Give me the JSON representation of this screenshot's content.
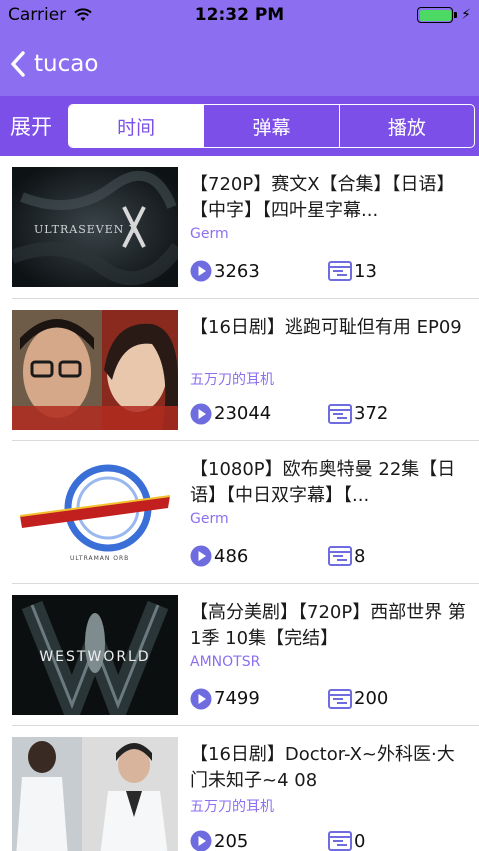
{
  "status_bar": {
    "carrier": "Carrier",
    "time": "12:32 PM"
  },
  "nav": {
    "title": "tucao"
  },
  "filter": {
    "expand_label": "展开",
    "segments": [
      {
        "label": "时间",
        "active": true
      },
      {
        "label": "弹幕",
        "active": false
      },
      {
        "label": "播放",
        "active": false
      }
    ]
  },
  "videos": [
    {
      "title": "【720P】赛文X【合集】【日语】【中字】【四叶星字幕...",
      "uploader": "Germ",
      "plays": "3263",
      "danmaku": "13",
      "thumb_text": "ULTRASEVEN X"
    },
    {
      "title": "【16日剧】逃跑可耻但有用 EP09",
      "uploader": "五万刀的耳机",
      "plays": "23044",
      "danmaku": "372"
    },
    {
      "title": "【1080P】欧布奥特曼 22集【日语】【中日双字幕】【...",
      "uploader": "Germ",
      "plays": "486",
      "danmaku": "8",
      "thumb_text": "ULTRAMAN ORB"
    },
    {
      "title": "【高分美剧】【720P】西部世界 第1季 10集【完结】",
      "uploader": "AMNOTSR",
      "plays": "7499",
      "danmaku": "200",
      "thumb_text": "WESTWORLD"
    },
    {
      "title": "【16日剧】Doctor-X~外科医·大门未知子~4 08",
      "uploader": "五万刀的耳机",
      "plays": "205",
      "danmaku": "0"
    }
  ],
  "colors": {
    "nav": "#8c6ff0",
    "filter": "#7b4fe8",
    "accent": "#7b4fe8",
    "battery": "#4cd964"
  }
}
